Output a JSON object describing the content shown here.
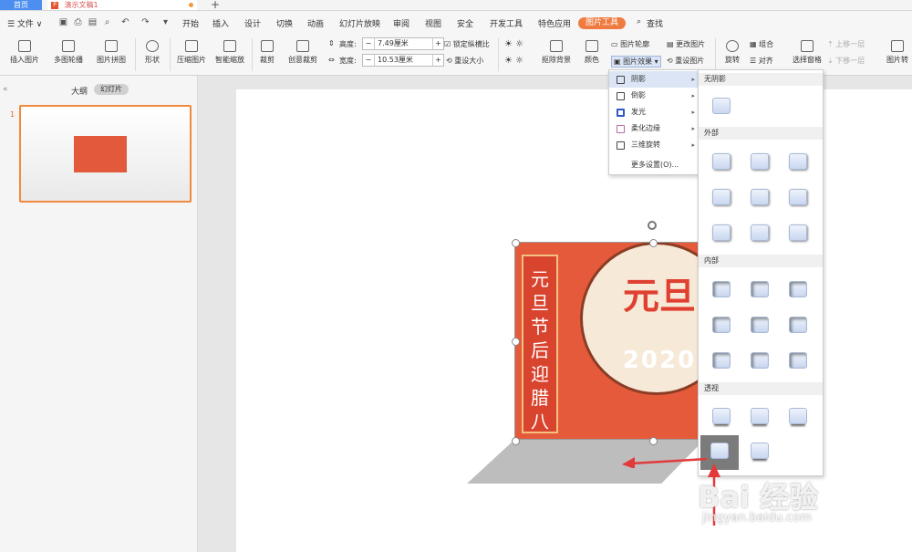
{
  "titlebar": {
    "home_tab": "首页",
    "doc_tab": "演示文稿1",
    "doc_icon": "P",
    "new_tab": "+"
  },
  "menubar": {
    "file": "☰ 文件 ∨",
    "items": [
      "开始",
      "插入",
      "设计",
      "切换",
      "动画",
      "幻灯片放映",
      "审阅",
      "视图",
      "安全",
      "开发工具",
      "特色应用"
    ],
    "active": "图片工具",
    "search": "查找"
  },
  "ribbon": {
    "insert_picture": "插入图片",
    "multi_outline": "多图轮播",
    "picture_collage": "图片拼图",
    "shape": "形状",
    "compress": "压缩图片",
    "smart_zoom": "智能缩放",
    "crop": "裁剪",
    "creative_crop": "创意裁剪",
    "height_label": "高度:",
    "height_value": "7.49厘米",
    "width_label": "宽度:",
    "width_value": "10.53厘米",
    "lock_ratio": "锁定纵横比",
    "reset_size": "重设大小",
    "remove_bg": "抠除背景",
    "color": "颜色",
    "picture_outline": "图片轮廓",
    "picture_effect": "图片效果",
    "change_picture": "更改图片",
    "reset_picture": "重设图片",
    "rotate": "旋转",
    "group": "组合",
    "align": "对齐",
    "selection_pane": "选择窗格",
    "bring_forward": "上移一层",
    "send_backward": "下移一层",
    "picture_convert": "图片转"
  },
  "leftpanel": {
    "collapse": "«",
    "outline": "大纲",
    "slides": "幻灯片",
    "slide_number": "1"
  },
  "slide_picture": {
    "banner_text": "元旦节后迎腊八",
    "circle_title": "元旦",
    "year": "2020"
  },
  "effects_menu": {
    "items": [
      {
        "label": "阴影",
        "has_sub": true
      },
      {
        "label": "倒影",
        "has_sub": true
      },
      {
        "label": "发光",
        "has_sub": true
      },
      {
        "label": "柔化边缘",
        "has_sub": true
      },
      {
        "label": "三维旋转",
        "has_sub": true
      },
      {
        "label": "更多设置(O)...",
        "has_sub": false
      }
    ]
  },
  "shadow_panel": {
    "no_shadow": "无阴影",
    "outer": "外部",
    "inner": "内部",
    "perspective": "透视"
  },
  "watermark": {
    "brand": "Bai 经验",
    "url": "jingyan.baidu.com"
  },
  "colors": {
    "accent": "#f07b40",
    "tab_blue": "#4d8ff0",
    "picture_red": "#e55a3b",
    "arrow_red": "#e23a3a"
  }
}
